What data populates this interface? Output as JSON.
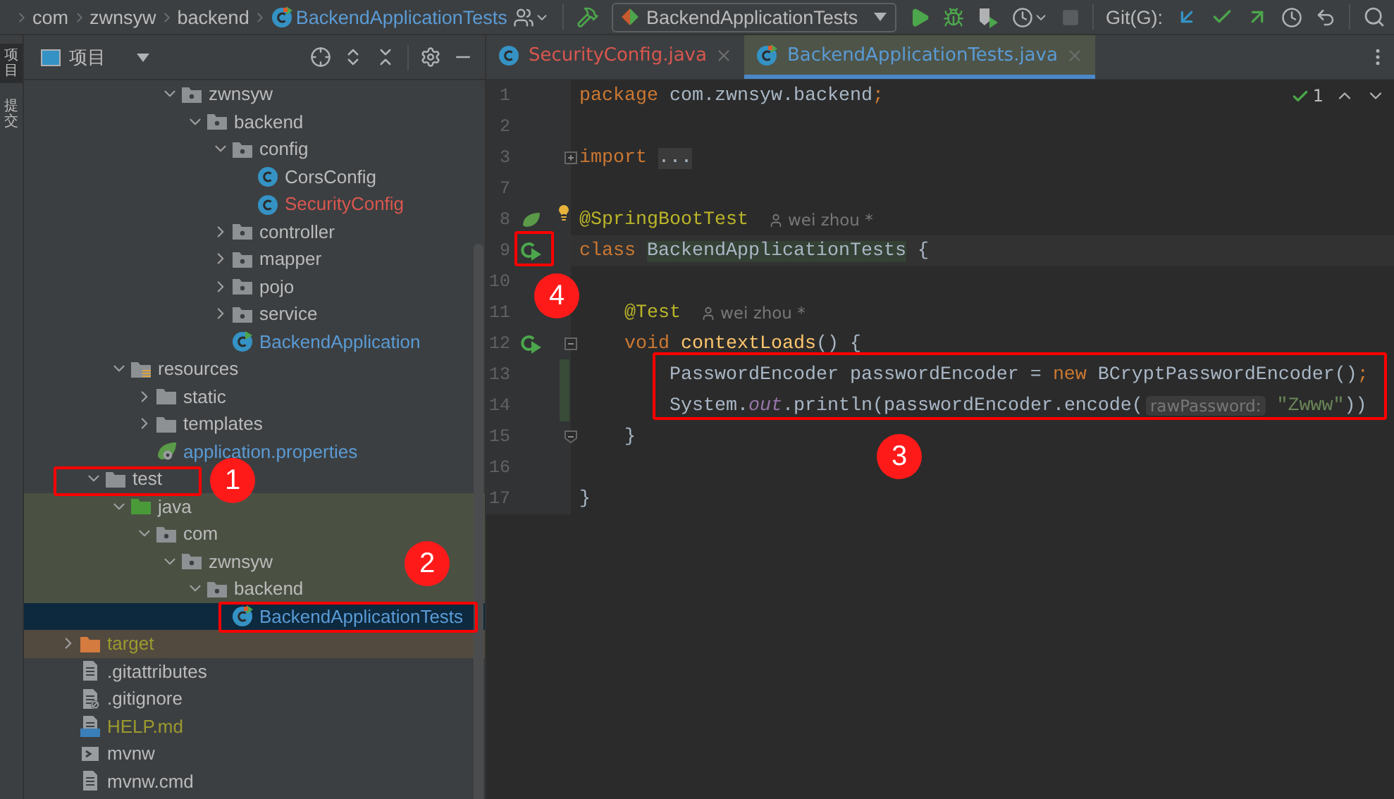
{
  "breadcrumb": [
    "com",
    "zwnsyw",
    "backend",
    "BackendApplicationTests"
  ],
  "run_config": "BackendApplicationTests",
  "git_label": "Git(G):",
  "side_strip": [
    {
      "label": "项目",
      "selected": true
    },
    {
      "label": "提交",
      "selected": false
    }
  ],
  "project_panel": {
    "title": "项目"
  },
  "tree": [
    {
      "children": [
        {
          "children": [
            {
              "children": [
                {
                  "children": [
                    {
                      "label": "zwnsyw",
                      "kind": "package",
                      "expanded": true,
                      "selected": false,
                      "children": [
                        {
                          "label": "backend",
                          "kind": "package",
                          "expanded": true,
                          "selected": false,
                          "children": [
                            {
                              "label": "config",
                              "kind": "package",
                              "expanded": true,
                              "selected": false,
                              "children": [
                                {
                                  "label": "CorsConfig",
                                  "kind": "class",
                                  "selected": false
                                },
                                {
                                  "label": "SecurityConfig",
                                  "kind": "class",
                                  "selected": false,
                                  "color": "#d9574f"
                                }
                              ]
                            },
                            {
                              "label": "controller",
                              "kind": "package",
                              "expanded": false,
                              "selected": false
                            },
                            {
                              "label": "mapper",
                              "kind": "package",
                              "expanded": false,
                              "selected": false
                            },
                            {
                              "label": "pojo",
                              "kind": "package",
                              "expanded": false,
                              "selected": false
                            },
                            {
                              "label": "service",
                              "kind": "package",
                              "expanded": false,
                              "selected": false
                            },
                            {
                              "label": "BackendApplication",
                              "kind": "spring-class",
                              "selected": false,
                              "color": "#5a9bd5"
                            }
                          ]
                        }
                      ]
                    }
                  ]
                }
              ]
            },
            {
              "label": "resources",
              "kind": "resources",
              "expanded": true,
              "selected": false,
              "children": [
                {
                  "label": "static",
                  "kind": "folder",
                  "expanded": false,
                  "selected": false
                },
                {
                  "label": "templates",
                  "kind": "folder",
                  "expanded": false,
                  "selected": false
                },
                {
                  "label": "application.properties",
                  "kind": "properties",
                  "selected": false,
                  "color": "#5a9bd5"
                }
              ]
            }
          ]
        },
        {
          "label": "test",
          "kind": "test-folder",
          "expanded": true,
          "selected": false,
          "children": [
            {
              "label": "java",
              "kind": "source-root",
              "expanded": true,
              "selected": false,
              "children": [
                {
                  "label": "com",
                  "kind": "package",
                  "expanded": true,
                  "selected": false,
                  "children": [
                    {
                      "label": "zwnsyw",
                      "kind": "package",
                      "expanded": true,
                      "selected": false,
                      "children": [
                        {
                          "label": "backend",
                          "kind": "package",
                          "expanded": true,
                          "selected": false,
                          "children": [
                            {
                              "label": "BackendApplicationTests",
                              "kind": "test-class",
                              "selected": true,
                              "color": "#5a9bd5"
                            }
                          ]
                        }
                      ]
                    }
                  ]
                }
              ]
            }
          ]
        }
      ]
    },
    {
      "label": "target",
      "kind": "excluded",
      "expanded": false,
      "selected": false,
      "color": "#9c9a2f"
    },
    {
      "label": ".gitattributes",
      "kind": "file",
      "selected": false
    },
    {
      "label": ".gitignore",
      "kind": "gitignore",
      "selected": false
    },
    {
      "label": "HELP.md",
      "kind": "markdown",
      "selected": false,
      "color": "#9c9a2f"
    },
    {
      "label": "mvnw",
      "kind": "script",
      "selected": false
    },
    {
      "label": "mvnw.cmd",
      "kind": "file",
      "selected": false
    }
  ],
  "editor_tabs": [
    {
      "label": "SecurityConfig.java",
      "selected": false,
      "color": "#d9574f"
    },
    {
      "label": "BackendApplicationTests.java",
      "selected": true,
      "color": "#5a9bd5"
    }
  ],
  "inspections": {
    "count": "1"
  },
  "code_lines": [
    {
      "number": "1",
      "tokens": [
        {
          "text": "package",
          "kind": "keyword"
        },
        {
          "text": " com.zwnsyw.backend",
          "kind": "plain"
        },
        {
          "text": ";",
          "kind": "keyword"
        }
      ]
    },
    {
      "number": "2"
    },
    {
      "number": "3",
      "fold_start": true,
      "folded": true,
      "tokens": [
        {
          "text": "import",
          "kind": "keyword"
        },
        {
          "text": "...",
          "kind": "folded"
        }
      ]
    },
    {
      "number": "7"
    },
    {
      "number": "8",
      "spring_bean": true,
      "bulb": true,
      "tokens": [
        {
          "text": "@SpringBootTest",
          "kind": "annotation"
        },
        {
          "text": "wei zhou *",
          "kind": "author"
        }
      ]
    },
    {
      "number": "9",
      "runnable": true,
      "current": true,
      "tokens": [
        {
          "text": "class",
          "kind": "keyword"
        },
        {
          "text": "BackendApplicationTests",
          "kind": "highlight"
        },
        {
          "text": " {",
          "kind": "plain"
        }
      ]
    },
    {
      "number": "10"
    },
    {
      "number": "11",
      "tokens": [
        {
          "text": "    @Test",
          "kind": "annotation"
        },
        {
          "text": "wei zhou *",
          "kind": "author"
        }
      ]
    },
    {
      "number": "12",
      "runnable": true,
      "fold_start": true,
      "folded": false,
      "tokens": [
        {
          "text": "    void",
          "kind": "keyword"
        },
        {
          "text": "contextLoads",
          "kind": "method"
        },
        {
          "text": "() {",
          "kind": "plain"
        }
      ]
    },
    {
      "number": "13",
      "changed": true,
      "tokens": [
        {
          "text": "        PasswordEncoder passwordEncoder = ",
          "kind": "plain"
        },
        {
          "text": "new",
          "kind": "keyword"
        },
        {
          "text": " BCryptPasswordEncoder()",
          "kind": "plain"
        },
        {
          "text": ";",
          "kind": "keyword"
        }
      ]
    },
    {
      "number": "14",
      "changed": true,
      "tokens": [
        {
          "text": "        System.",
          "kind": "plain"
        },
        {
          "text": "out",
          "kind": "static"
        },
        {
          "text": ".println(passwordEncoder.encode(",
          "kind": "plain"
        },
        {
          "text": "rawPassword:",
          "kind": "hint"
        },
        {
          "text": "\"Zwww\"",
          "kind": "string"
        },
        {
          "text": "))",
          "kind": "plain"
        }
      ]
    },
    {
      "number": "15",
      "fold_end": true,
      "tokens": [
        {
          "text": "    }",
          "kind": "plain"
        }
      ]
    },
    {
      "number": "16"
    },
    {
      "number": "17",
      "tokens": [
        {
          "text": "}",
          "kind": "plain"
        }
      ]
    }
  ],
  "callouts": [
    {
      "label": "1"
    },
    {
      "label": "2"
    },
    {
      "label": "3"
    },
    {
      "label": "4"
    }
  ]
}
